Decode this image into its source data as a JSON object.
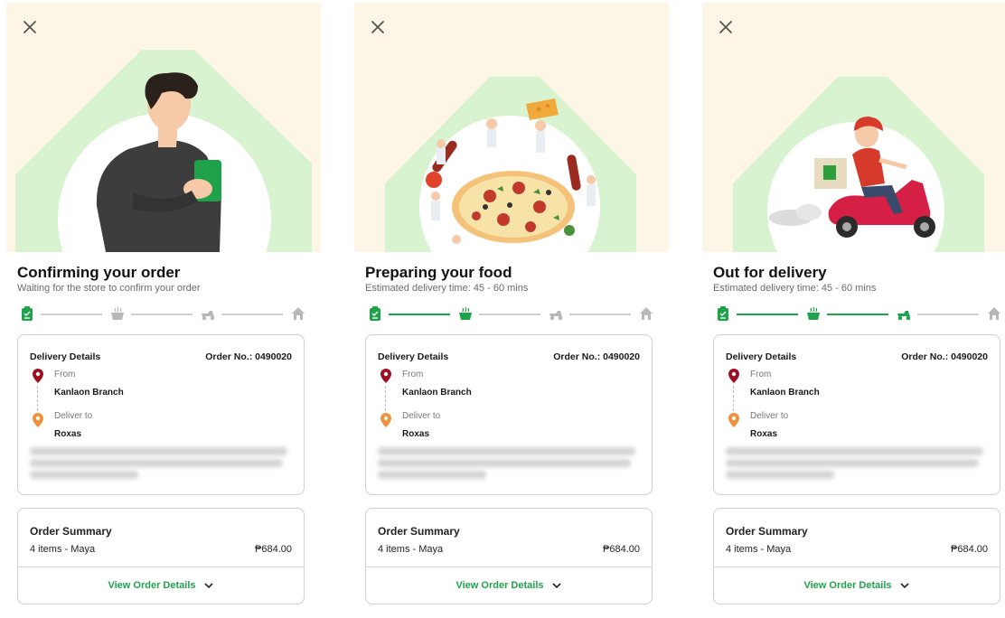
{
  "colors": {
    "accent_green": "#1ea34a",
    "inactive_grey": "#b8b8b8",
    "hero_bg": "#fdf5e6",
    "hero_shape": "#d8f3cf",
    "pin_from": "#9b1022",
    "pin_to": "#f0913a"
  },
  "icons": {
    "close": "close-icon",
    "step1": "order-confirmed-icon",
    "step2": "cooking-pot-icon",
    "step3": "delivery-scooter-icon",
    "step4": "home-icon",
    "pin_from": "map-pin-icon",
    "pin_to": "map-pin-icon",
    "expand": "chevron-down-icon"
  },
  "screens": [
    {
      "illustration": "person-holding-phone",
      "title": "Confirming your order",
      "subtitle": "Waiting for the store to confirm your order",
      "progress_completed_steps": 1,
      "delivery_details": {
        "heading": "Delivery Details",
        "order_no_label": "Order No.:",
        "order_no": "0490020",
        "from_label": "From",
        "from_value": "Kanlaon Branch",
        "to_label": "Deliver to",
        "to_value": "Roxas"
      },
      "order_summary": {
        "heading": "Order Summary",
        "items": "4 items - Maya",
        "price": "₱684.00",
        "button": "View Order Details"
      }
    },
    {
      "illustration": "chefs-preparing-pizza",
      "title": "Preparing your food",
      "subtitle": "Estimated delivery time: 45 - 60 mins",
      "progress_completed_steps": 2,
      "delivery_details": {
        "heading": "Delivery Details",
        "order_no_label": "Order No.:",
        "order_no": "0490020",
        "from_label": "From",
        "from_value": "Kanlaon Branch",
        "to_label": "Deliver to",
        "to_value": "Roxas"
      },
      "order_summary": {
        "heading": "Order Summary",
        "items": "4 items - Maya",
        "price": "₱684.00",
        "button": "View Order Details"
      }
    },
    {
      "illustration": "rider-on-scooter",
      "title": "Out for delivery",
      "subtitle": "Estimated delivery time: 45 - 60 mins",
      "progress_completed_steps": 3,
      "delivery_details": {
        "heading": "Delivery Details",
        "order_no_label": "Order No.:",
        "order_no": "0490020",
        "from_label": "From",
        "from_value": "Kanlaon Branch",
        "to_label": "Deliver to",
        "to_value": "Roxas"
      },
      "order_summary": {
        "heading": "Order Summary",
        "items": "4 items - Maya",
        "price": "₱684.00",
        "button": "View Order Details"
      }
    }
  ]
}
